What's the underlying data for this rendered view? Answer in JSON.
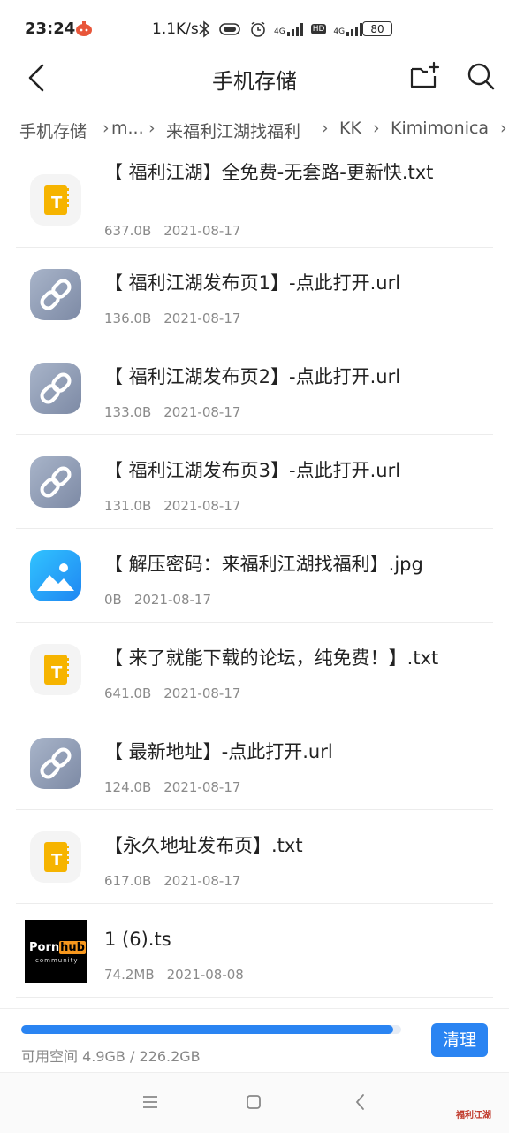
{
  "status_bar": {
    "time": "23:24",
    "speed": "1.1K/s",
    "signal1": "4G",
    "signal2": "4G",
    "hd": "HD",
    "battery": "80"
  },
  "header": {
    "title": "手机存储"
  },
  "breadcrumb": [
    "手机存储",
    "m...",
    "来福利江湖找福利",
    "KK",
    "Kimimonica"
  ],
  "files": [
    {
      "name": "【 福利江湖】全免费-无套路-更新快.txt",
      "size": "637.0B",
      "date": "2021-08-17",
      "type": "txt"
    },
    {
      "name": "【 福利江湖发布页1】-点此打开.url",
      "size": "136.0B",
      "date": "2021-08-17",
      "type": "url"
    },
    {
      "name": "【 福利江湖发布页2】-点此打开.url",
      "size": "133.0B",
      "date": "2021-08-17",
      "type": "url"
    },
    {
      "name": "【 福利江湖发布页3】-点此打开.url",
      "size": "131.0B",
      "date": "2021-08-17",
      "type": "url"
    },
    {
      "name": "【 解压密码：来福利江湖找福利】.jpg",
      "size": "0B",
      "date": "2021-08-17",
      "type": "jpg"
    },
    {
      "name": "【 来了就能下载的论坛，纯免费！】.txt",
      "size": "641.0B",
      "date": "2021-08-17",
      "type": "txt"
    },
    {
      "name": "【 最新地址】-点此打开.url",
      "size": "124.0B",
      "date": "2021-08-17",
      "type": "url"
    },
    {
      "name": "【永久地址发布页】.txt",
      "size": "617.0B",
      "date": "2021-08-17",
      "type": "txt"
    },
    {
      "name": "1 (6).ts",
      "size": "74.2MB",
      "date": "2021-08-08",
      "type": "video"
    }
  ],
  "thumbnail_logo": {
    "part1": "Porn",
    "part2": "hub",
    "sub": "community"
  },
  "storage": {
    "free_text": "可用空间 4.9GB / 226.2GB",
    "used_fraction": 0.978,
    "clean_label": "清理"
  },
  "watermark": "福利江湖",
  "colors": {
    "accent": "#2a84f2",
    "txt_icon": "#f6b400"
  }
}
